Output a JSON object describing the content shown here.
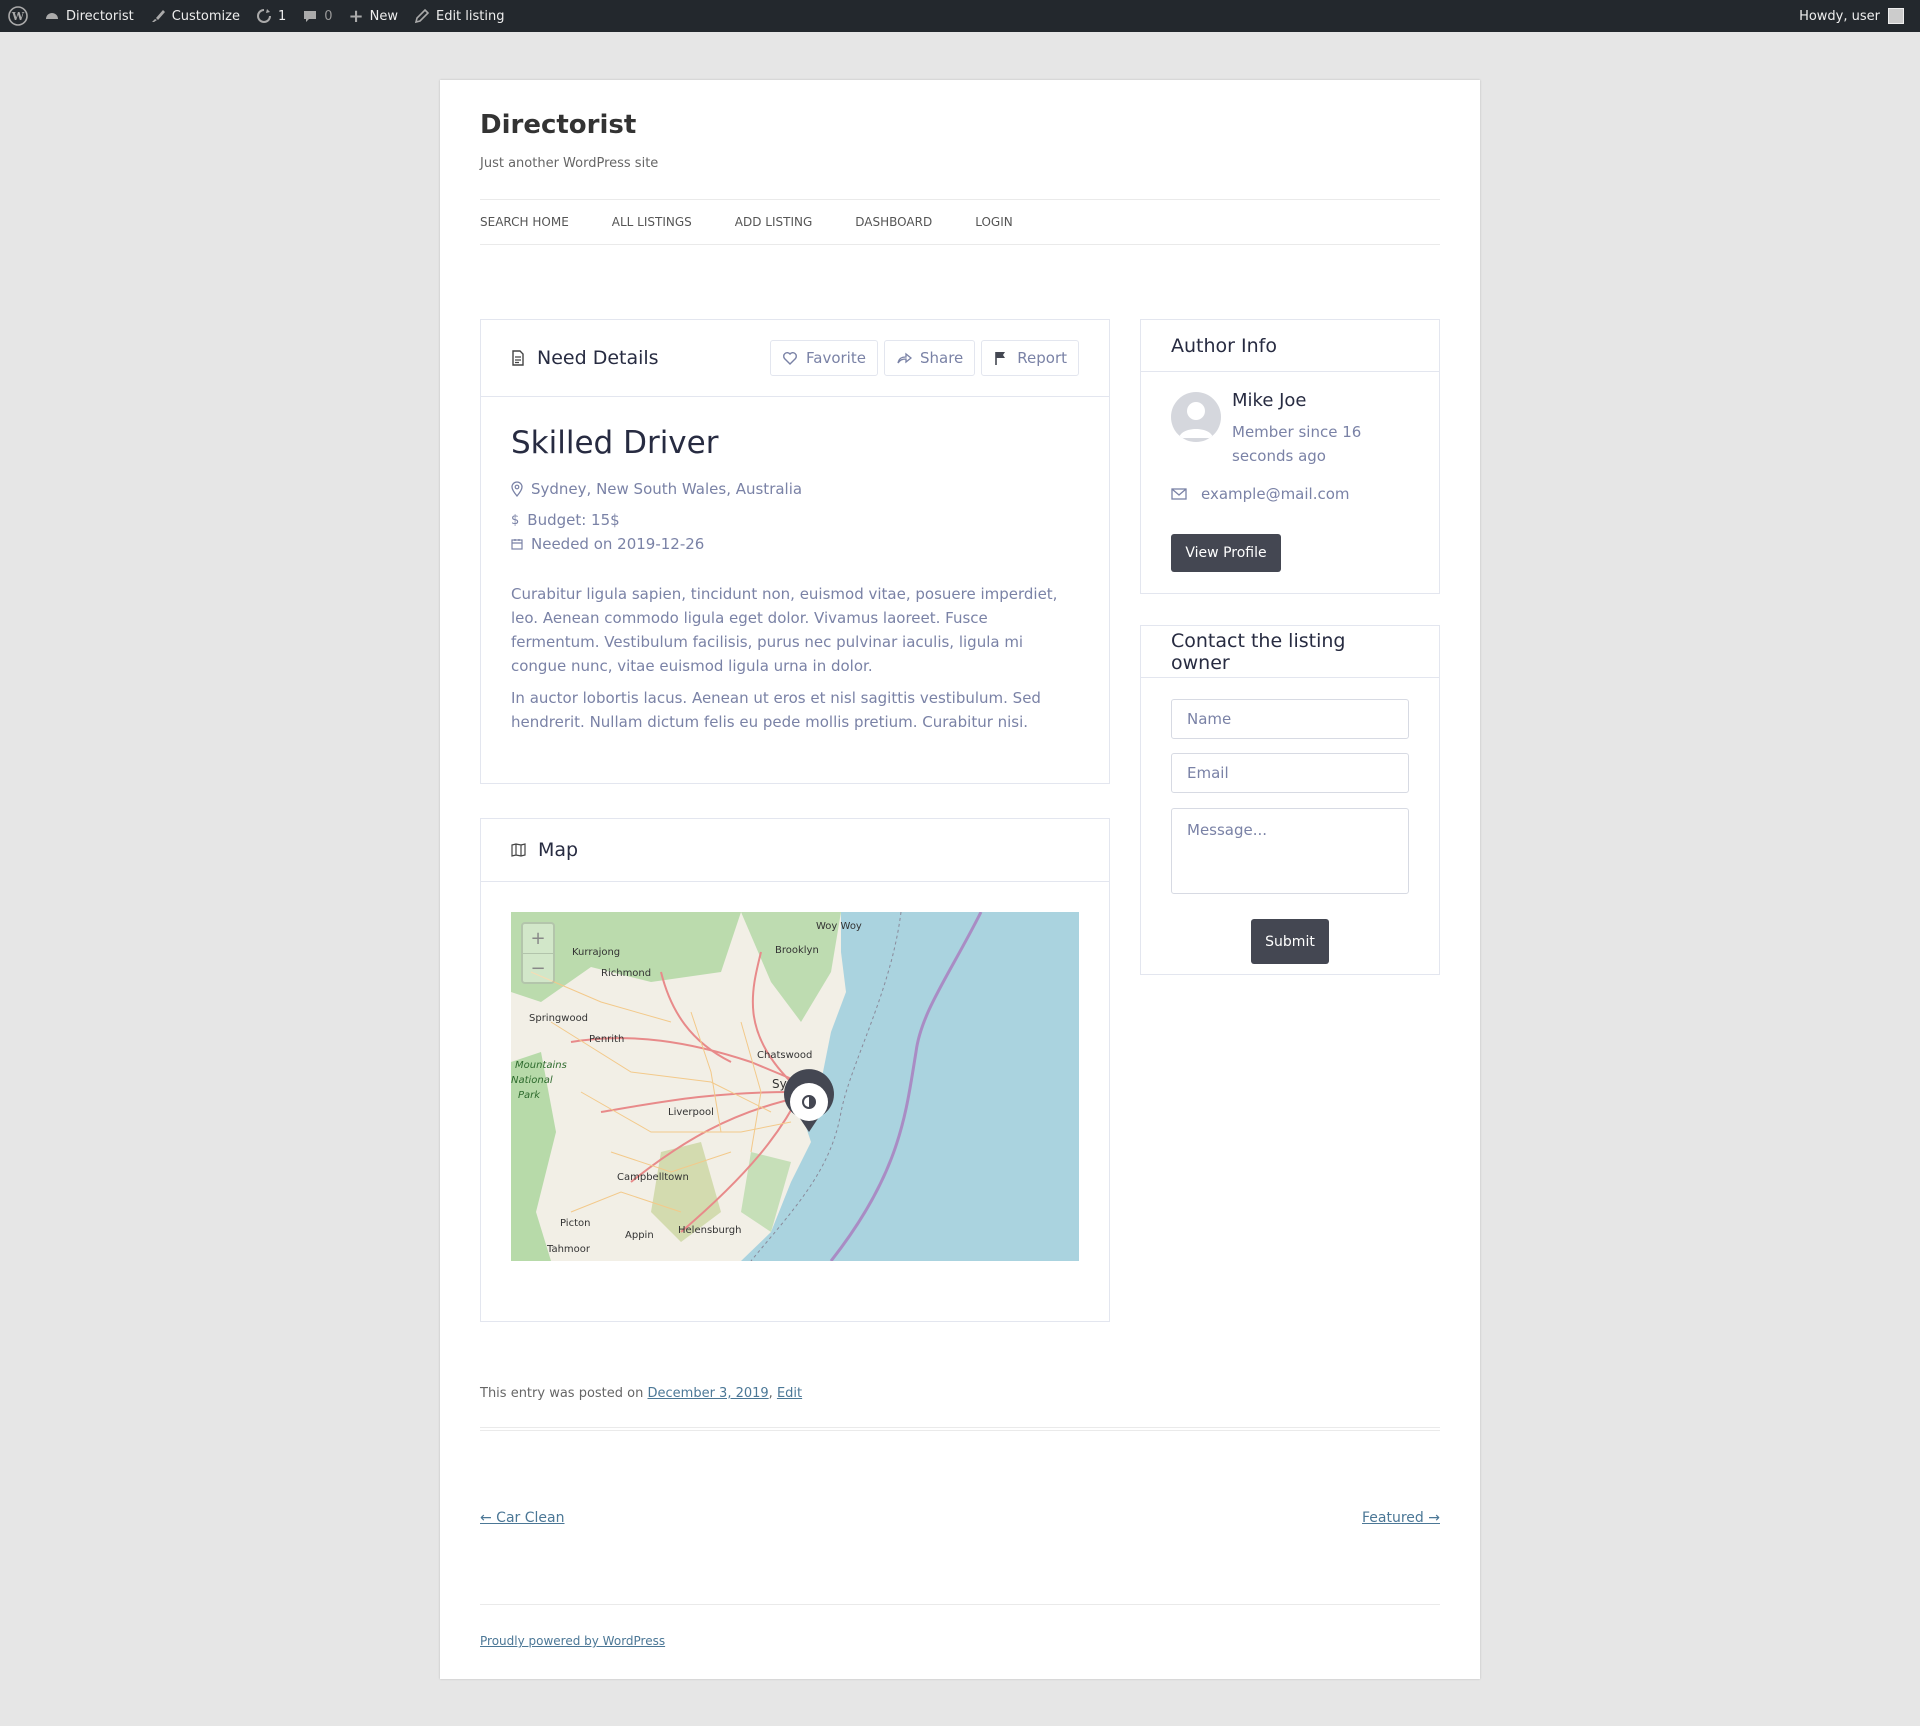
{
  "adminbar": {
    "site": "Directorist",
    "customize": "Customize",
    "updates": "1",
    "comments": "0",
    "new": "New",
    "edit": "Edit listing",
    "howdy": "Howdy, user"
  },
  "site": {
    "title": "Directorist",
    "description": "Just another WordPress site"
  },
  "nav": [
    "SEARCH HOME",
    "ALL LISTINGS",
    "ADD LISTING",
    "DASHBOARD",
    "LOGIN"
  ],
  "details": {
    "heading": "Need Details",
    "actions": {
      "favorite": "Favorite",
      "share": "Share",
      "report": "Report"
    },
    "title": "Skilled Driver",
    "location": "Sydney, New South Wales, Australia",
    "budget": "Budget: 15$",
    "needed": "Needed on 2019-12-26",
    "paragraphs": [
      "Curabitur ligula sapien, tincidunt non, euismod vitae, posuere imperdiet, leo. Aenean commodo ligula eget dolor. Vivamus laoreet. Fusce fermentum. Vestibulum facilisis, purus nec pulvinar iaculis, ligula mi congue nunc, vitae euismod ligula urna in dolor.",
      "In auctor lobortis lacus. Aenean ut eros et nisl sagittis vestibulum. Sed hendrerit. Nullam dictum felis eu pede mollis pretium. Curabitur nisi."
    ]
  },
  "map": {
    "heading": "Map",
    "zoom_in": "+",
    "zoom_out": "−",
    "places": [
      "Woy Woy",
      "Kurrajong",
      "Brooklyn",
      "Richmond",
      "Springwood",
      "Penrith",
      "Chatswood",
      "Mountains",
      "National",
      "Park",
      "Sy",
      "Liverpool",
      "Campbelltown",
      "Picton",
      "Appin",
      "Helensburgh",
      "Tahmoor"
    ],
    "colors": {
      "land": "#f2efe6",
      "sea": "#aad3df",
      "park": "#a8d49a",
      "road": "#e88a8a",
      "minor_road": "#f3c98a"
    }
  },
  "author": {
    "heading": "Author Info",
    "name": "Mike Joe",
    "member": "Member since 16 seconds ago",
    "email": "example@mail.com",
    "view_profile": "View Profile"
  },
  "contact": {
    "heading": "Contact the listing owner",
    "name_placeholder": "Name",
    "email_placeholder": "Email",
    "message_placeholder": "Message...",
    "submit": "Submit"
  },
  "entry": {
    "posted_prefix": "This entry was posted on",
    "date": "December 3, 2019",
    "edit": "Edit",
    "prev": "← Car Clean",
    "next": "Featured →",
    "powered": "Proudly powered by WordPress"
  }
}
